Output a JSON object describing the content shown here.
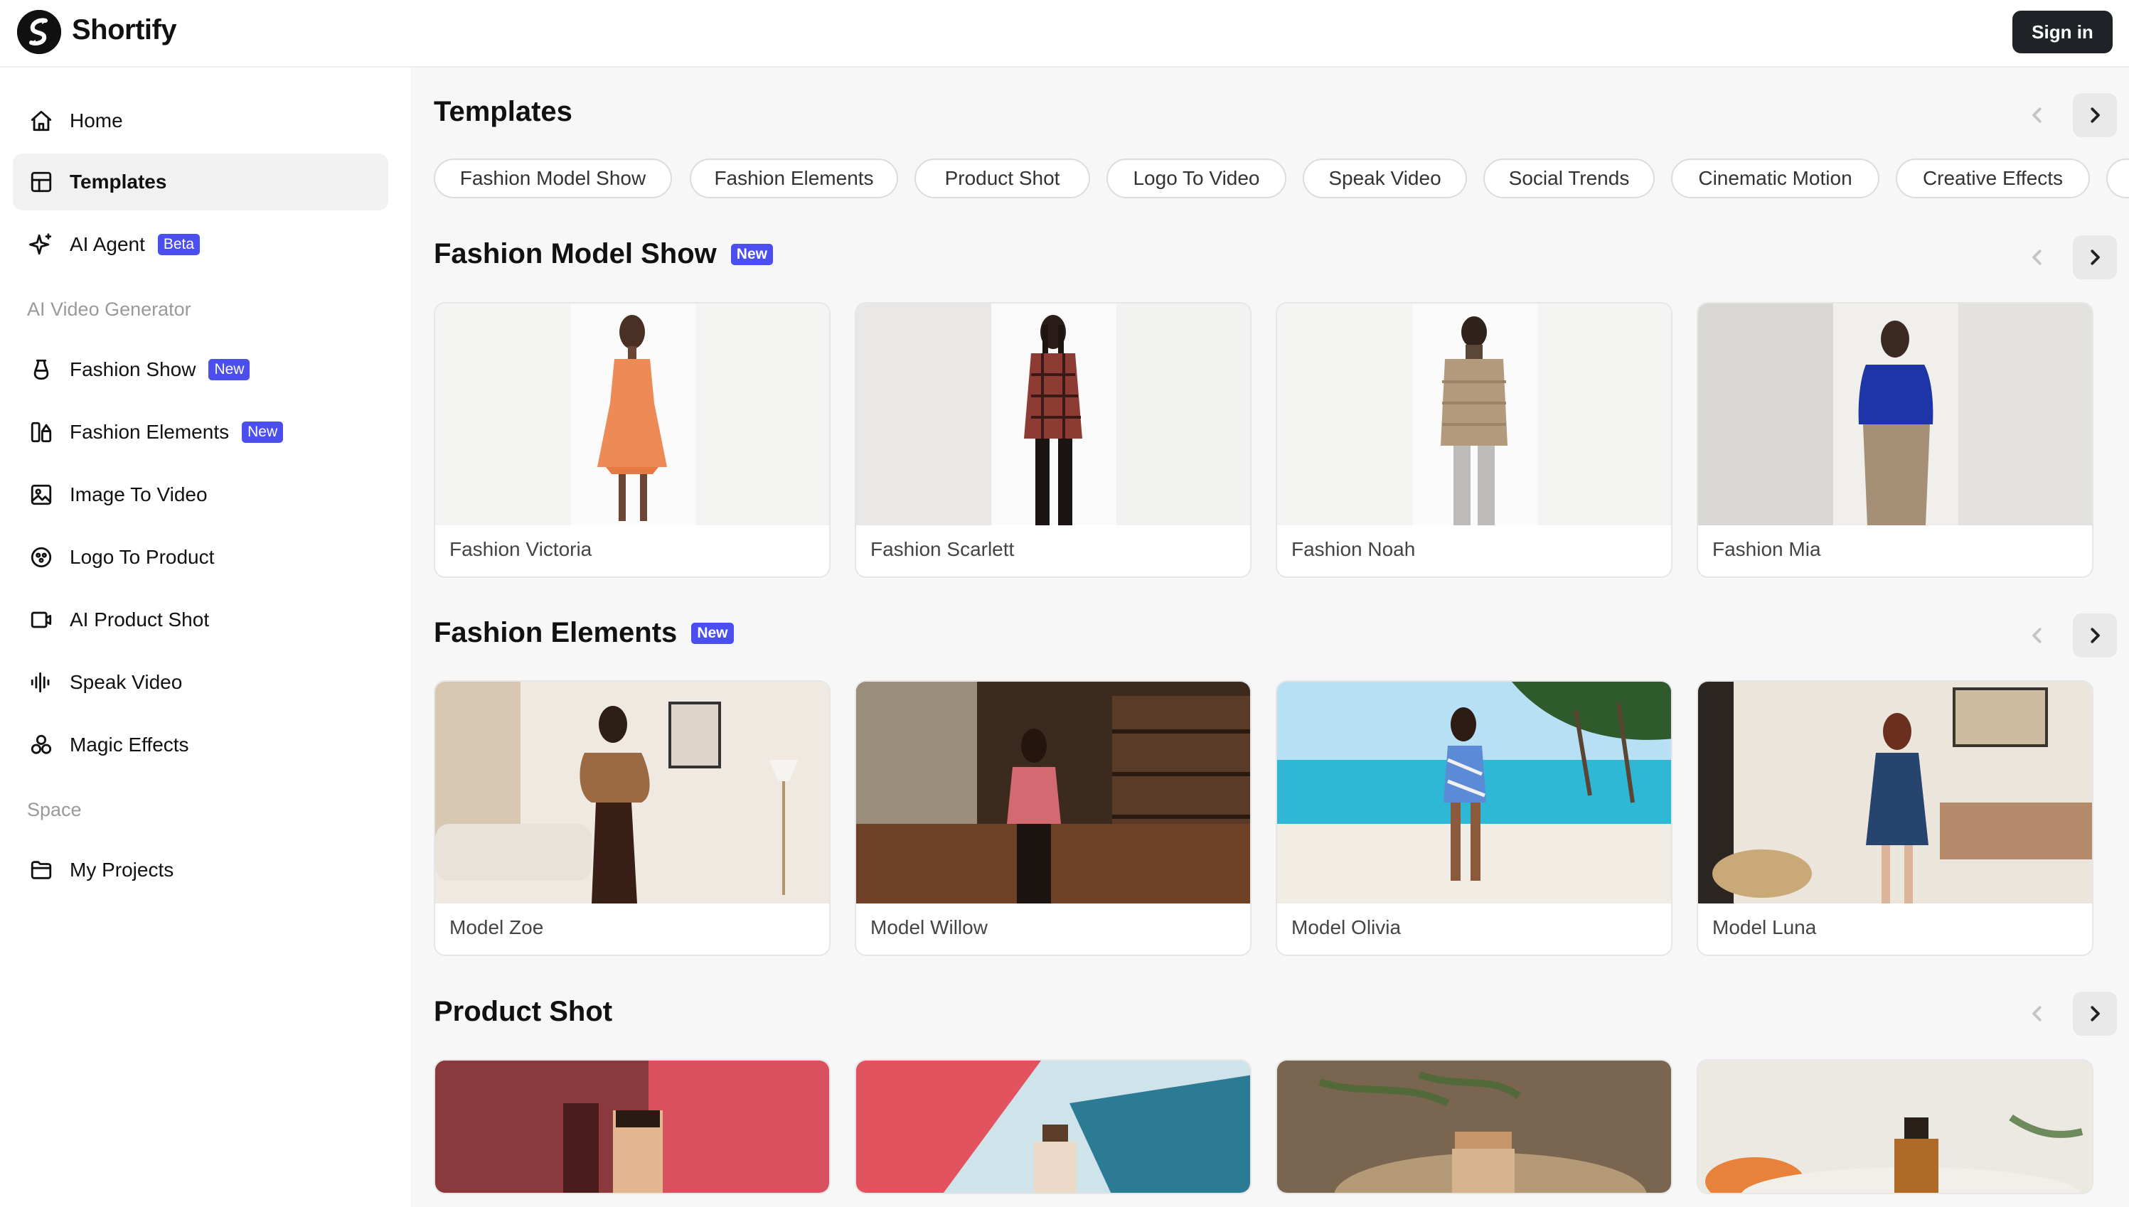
{
  "app": {
    "name": "Shortify",
    "sign_in": "Sign in"
  },
  "sidebar": {
    "items": [
      {
        "label": "Home",
        "icon": "home-icon"
      },
      {
        "label": "Templates",
        "icon": "grid-icon",
        "active": true
      },
      {
        "label": "AI Agent",
        "icon": "sparkle-icon",
        "badge": "Beta"
      }
    ],
    "section_video": "AI Video Generator",
    "video_items": [
      {
        "label": "Fashion Show",
        "icon": "dress-form-icon",
        "badge": "New"
      },
      {
        "label": "Fashion Elements",
        "icon": "shapes-icon",
        "badge": "New"
      },
      {
        "label": "Image To Video",
        "icon": "image-icon"
      },
      {
        "label": "Logo To Product",
        "icon": "target-icon"
      },
      {
        "label": "AI Product Shot",
        "icon": "camera-icon"
      },
      {
        "label": "Speak Video",
        "icon": "waveform-icon"
      },
      {
        "label": "Magic Effects",
        "icon": "magic-icon"
      }
    ],
    "section_space": "Space",
    "space_items": [
      {
        "label": "My Projects",
        "icon": "folder-icon"
      }
    ]
  },
  "templates": {
    "title": "Templates",
    "chips": [
      "Fashion Model Show",
      "Fashion Elements",
      "Product Shot",
      "Logo To Video",
      "Speak Video",
      "Social Trends",
      "Cinematic Motion",
      "Creative Effects"
    ]
  },
  "fashion_model_show": {
    "title": "Fashion Model Show",
    "badge": "New",
    "cards": [
      "Fashion Victoria",
      "Fashion Scarlett",
      "Fashion Noah",
      "Fashion Mia"
    ]
  },
  "fashion_elements": {
    "title": "Fashion Elements",
    "badge": "New",
    "cards": [
      "Model Zoe",
      "Model Willow",
      "Model Olivia",
      "Model Luna"
    ]
  },
  "product_shot": {
    "title": "Product Shot"
  },
  "colors": {
    "accent": "#4b4ff0",
    "signin_bg": "#1f2328"
  }
}
